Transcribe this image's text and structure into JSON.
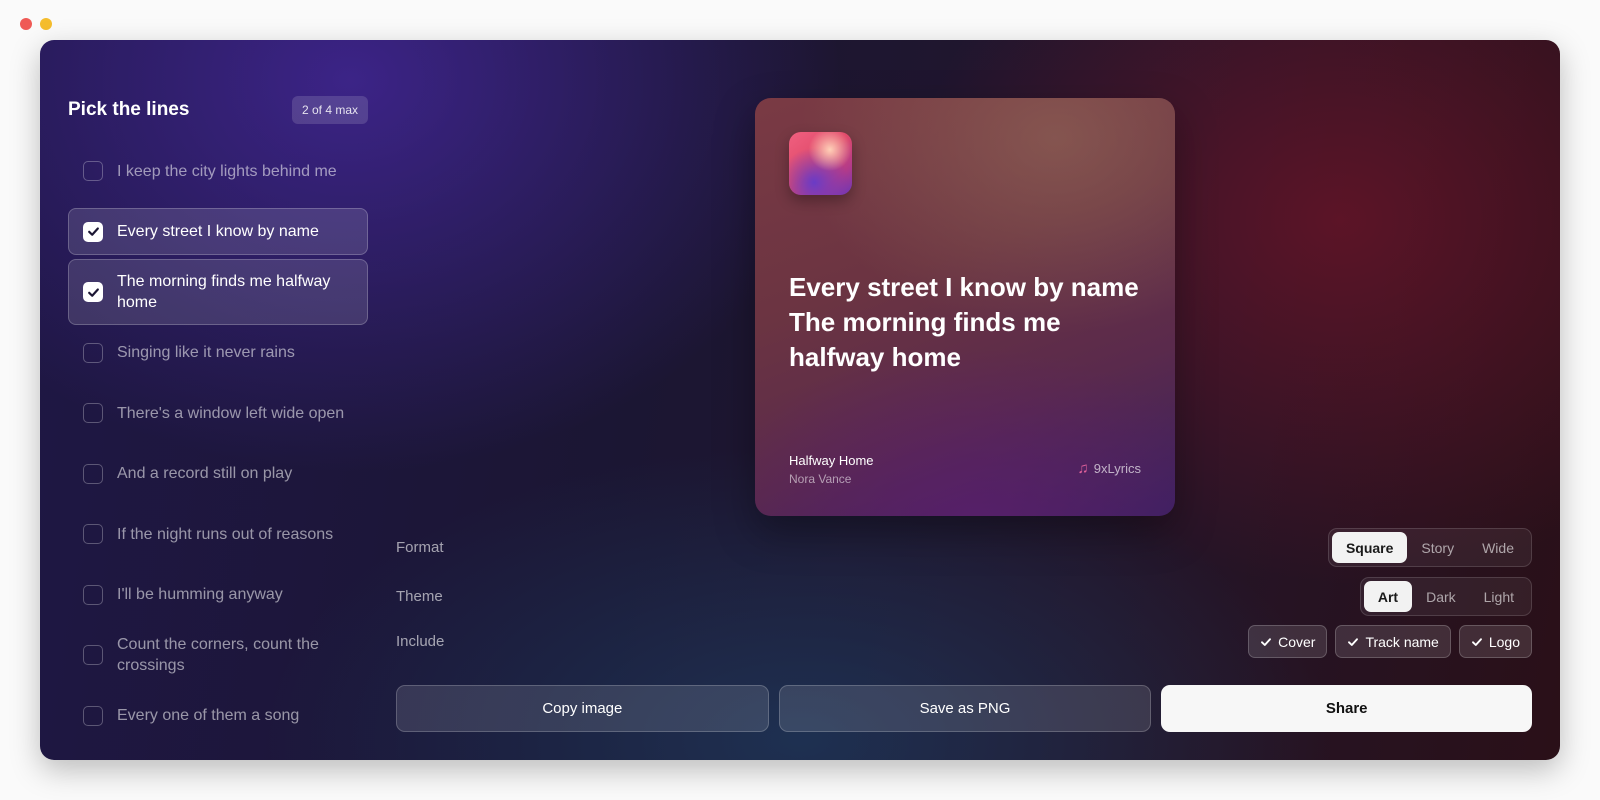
{
  "window": {
    "controls": [
      "close",
      "minimize"
    ]
  },
  "picker": {
    "title": "Pick the lines",
    "count_badge": "2 of 4 max",
    "lines": [
      {
        "text": "I keep the city lights behind me",
        "selected": false
      },
      {
        "text": "Every street I know by name",
        "selected": true
      },
      {
        "text": "The morning finds me halfway home",
        "selected": true
      },
      {
        "text": "Singing like it never rains",
        "selected": false
      },
      {
        "text": "There's a window left wide open",
        "selected": false
      },
      {
        "text": "And a record still on play",
        "selected": false
      },
      {
        "text": "If the night runs out of reasons",
        "selected": false
      },
      {
        "text": "I'll be humming anyway",
        "selected": false
      },
      {
        "text": "Count the corners, count the crossings",
        "selected": false
      },
      {
        "text": "Every one of them a song",
        "selected": false
      }
    ]
  },
  "preview": {
    "lyrics": [
      "Every street I know by name",
      "The morning finds me halfway home"
    ],
    "track_title": "Halfway Home",
    "artist": "Nora Vance",
    "logo_text": "9xLyrics",
    "logo_icon": "music-note-icon"
  },
  "options": {
    "format": {
      "label": "Format",
      "choices": [
        "Square",
        "Story",
        "Wide"
      ],
      "selected": "Square"
    },
    "theme": {
      "label": "Theme",
      "choices": [
        "Art",
        "Dark",
        "Light"
      ],
      "selected": "Art"
    },
    "include": {
      "label": "Include",
      "items": [
        {
          "label": "Cover",
          "checked": true
        },
        {
          "label": "Track name",
          "checked": true
        },
        {
          "label": "Logo",
          "checked": true
        }
      ]
    }
  },
  "actions": {
    "copy": "Copy image",
    "save": "Save as PNG",
    "share": "Share"
  },
  "colors": {
    "accent_logo": "#e0609a",
    "primary_button": "#f7f7f7"
  }
}
